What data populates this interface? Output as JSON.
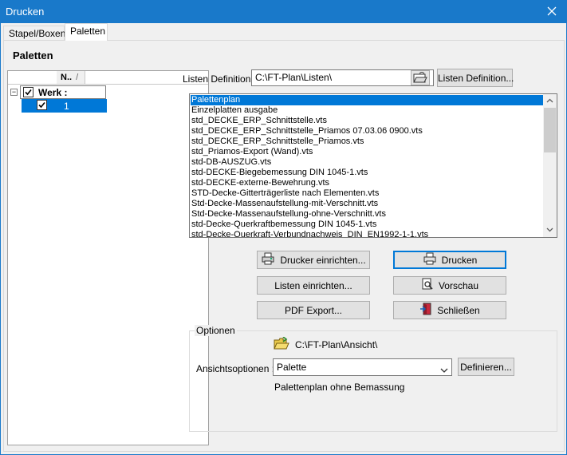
{
  "window": {
    "title": "Drucken"
  },
  "tabs": [
    {
      "label": "Stapel/Boxen"
    },
    {
      "label": "Paletten"
    }
  ],
  "panel": {
    "heading": "Paletten"
  },
  "grid": {
    "column_header": "N..",
    "sort_glyph": "/",
    "group_label": "Werk :",
    "group_checked": true,
    "row_value": "1",
    "row_checked": true
  },
  "listdef": {
    "label": "Listen Definition :",
    "path": "C:\\FT-Plan\\Listen\\",
    "button": "Listen Definition..."
  },
  "list_items": [
    "Palettenplan",
    "Einzelplatten ausgabe",
    "std_DECKE_ERP_Schnittstelle.vts",
    "std_DECKE_ERP_Schnittstelle_Priamos 07.03.06 0900.vts",
    "std_DECKE_ERP_Schnittstelle_Priamos.vts",
    "std_Priamos-Export (Wand).vts",
    "std-DB-AUSZUG.vts",
    "std-DECKE-Biegebemessung DIN 1045-1.vts",
    "std-DECKE-externe-Bewehrung.vts",
    "STD-Decke-Gitterträgerliste nach Elementen.vts",
    "Std-Decke-Massenaufstellung-mit-Verschnitt.vts",
    "Std-Decke-Massenaufstellung-ohne-Verschnitt.vts",
    "std-Decke-Querkraftbemessung DIN 1045-1.vts",
    "std-Decke-Querkraft-Verbundnachweis_DIN_EN1992-1-1.vts"
  ],
  "selected_index": 0,
  "buttons": {
    "printer_setup": "Drucker einrichten...",
    "print": "Drucken",
    "list_setup": "Listen einrichten...",
    "preview": "Vorschau",
    "pdf_export": "PDF Export...",
    "close": "Schließen"
  },
  "options": {
    "legend": "Optionen",
    "view_path": "C:\\FT-Plan\\Ansicht\\",
    "view_options_label": "Ansichtsoptionen :",
    "view_options_value": "Palette",
    "define_button": "Definieren...",
    "description": "Palettenplan ohne Bemassung"
  },
  "colors": {
    "titlebar": "#1979ca",
    "selection": "#0078d7",
    "focus": "#0078d7"
  }
}
